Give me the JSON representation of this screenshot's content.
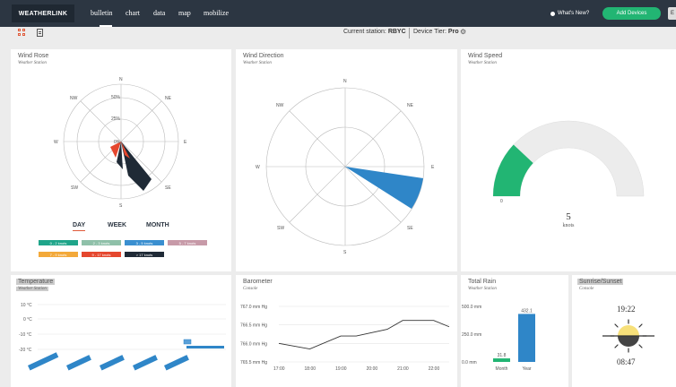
{
  "nav": {
    "logo": "WEATHERLINK",
    "items": [
      "bulletin",
      "chart",
      "data",
      "map",
      "mobilize"
    ],
    "whats_new": "What's New?",
    "add_devices": "Add Devices",
    "edge_label": "E"
  },
  "subbar": {
    "station_label": "Current station:",
    "station_value": "RBYC",
    "tier_label": "Device Tier:",
    "tier_value": "Pro"
  },
  "wind_rose": {
    "title": "Wind Rose",
    "subtitle": "Weather Station",
    "directions": [
      "N",
      "NE",
      "E",
      "SE",
      "S",
      "SW",
      "W",
      "NW"
    ],
    "rings": [
      "50%",
      "25%",
      "0%"
    ],
    "periods": [
      "DAY",
      "WEEK",
      "MONTH"
    ],
    "active_period": "DAY",
    "legend": [
      {
        "label": "0 - 2 knots",
        "color": "#1fa58a"
      },
      {
        "label": "2 - 3 knots",
        "color": "#8fc0a9"
      },
      {
        "label": "3 - 5 knots",
        "color": "#3a8fd0"
      },
      {
        "label": "5 - 7 knots",
        "color": "#c79aa8"
      },
      {
        "label": "7 - 9 knots",
        "color": "#f3a93a"
      },
      {
        "label": "9 - 17 knots",
        "color": "#e5472e"
      },
      {
        "label": "> 17 knots",
        "color": "#1f2a36"
      }
    ]
  },
  "wind_direction": {
    "title": "Wind Direction",
    "subtitle": "Weather Station",
    "directions": [
      "N",
      "NE",
      "E",
      "SE",
      "S",
      "SW",
      "W",
      "NW"
    ]
  },
  "wind_speed": {
    "title": "Wind Speed",
    "subtitle": "Weather Station",
    "min_label": "0",
    "value": "5",
    "unit": "knots",
    "fraction": 0.24
  },
  "temperature": {
    "title": "Temperature",
    "subtitle": "Weather Station",
    "y_labels": [
      "10 °C",
      "0 °C",
      "-10 °C",
      "-20 °C"
    ]
  },
  "barometer": {
    "title": "Barometer",
    "subtitle": "Console",
    "chart_data": {
      "type": "line",
      "x": [
        "17:00",
        "18:00",
        "19:00",
        "20:00",
        "21:00",
        "22:00"
      ],
      "y_ticks": [
        "767.0 mm Hg",
        "766.5 mm Hg",
        "766.0 mm Hg",
        "765.5 mm Hg"
      ],
      "ylim": [
        765.5,
        767.0
      ],
      "points": [
        {
          "t": 17.0,
          "v": 766.0
        },
        {
          "t": 18.0,
          "v": 765.85
        },
        {
          "t": 19.0,
          "v": 766.2
        },
        {
          "t": 19.5,
          "v": 766.2
        },
        {
          "t": 20.5,
          "v": 766.38
        },
        {
          "t": 21.0,
          "v": 766.62
        },
        {
          "t": 22.0,
          "v": 766.62
        },
        {
          "t": 22.5,
          "v": 766.45
        }
      ]
    }
  },
  "total_rain": {
    "title": "Total Rain",
    "subtitle": "Weather Station",
    "chart_data": {
      "type": "bar",
      "categories": [
        "Month",
        "Year"
      ],
      "values": [
        31.8,
        432.1
      ],
      "value_labels": [
        "31.8",
        "432.1"
      ],
      "y_ticks": [
        "500.0 mm",
        "250.0 mm",
        "0.0 mm"
      ],
      "ylim": [
        0,
        500
      ],
      "colors": [
        "#22b573",
        "#2f86c8"
      ]
    }
  },
  "sunrise_sunset": {
    "title": "Sunrise/Sunset",
    "subtitle": "Console",
    "sunset": "19:22",
    "sunrise": "08:47"
  }
}
